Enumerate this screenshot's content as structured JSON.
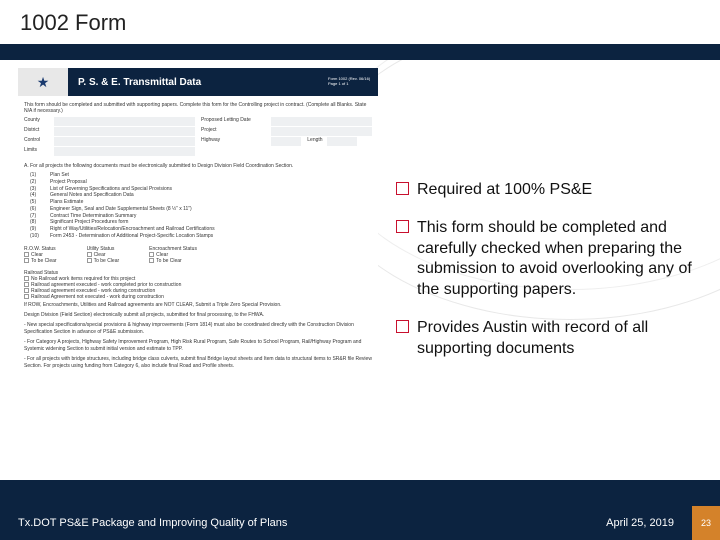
{
  "title": "1002 Form",
  "form_preview": {
    "header_title": "P. S. & E. Transmittal Data",
    "header_meta": "Form 1002\n(Rev. 06/16)\nPage 1 of 1",
    "intro": "This form should be completed and submitted with supporting papers. Complete this form for the Controlling project in contract. (Complete all Blanks. State N/A if necessary.)",
    "left_fields": [
      "County",
      "District",
      "Control",
      "Limits"
    ],
    "right_fields": [
      "Proposed Letting Date",
      "Project",
      "Highway"
    ],
    "length_label": "Length",
    "section_a": "A. For all projects the following documents must be electronically submitted to Design Division Field Coordination Section.",
    "docs": [
      "Plan Set",
      "Project Proposal",
      "List of Governing Specifications and Special Provisions",
      "General Notes and Specification Data",
      "Plans Estimate",
      "Engineer Sign, Seal and Date Supplemental Sheets (8 ½” x 11”)",
      "Contract Time Determination Summary",
      "Significant Project Procedures form",
      "Right of Way/Utilities/Relocation/Encroachment and Railroad Certifications",
      "Form 2453 - Determination of Additional Project-Specific Location Stamps"
    ],
    "status_labels": {
      "row": "R.O.W. Status",
      "util": "Utility Status",
      "enc": "Encroachment Status",
      "opts": [
        "Clear",
        "Clear",
        "Clear",
        "To be Clear",
        "To be Clear",
        "To be Clear"
      ]
    },
    "railroad": {
      "title": "Railroad Status",
      "items": [
        "No Railroad work items required for this project",
        "Railroad agreement executed - work completed prior to construction",
        "Railroad agreement executed - work during construction",
        "Railroad Agreement not executed - work during construction"
      ],
      "note": "If ROW, Encroachments, Utilities and Railroad agreements are NOT CLEAR, Submit a Triple Zero Special Provision."
    },
    "paras": [
      "Design Division (Field Section) electronically submit all projects, submitted for final processing, to the FHWA.",
      "- New special specifications/special provisions & highway improvements (Form 1814) must also be coordinated directly with the Construction Division Specification Section in advance of PS&E submission.",
      "- For Category A projects, Highway Safety Improvement Program, High Risk Rural Program, Safe Routes to School Program, Rail/Highway Program and Systemic widening Section to submit initial version and estimate to TPP.",
      "- For all projects with bridge structures, including bridge class culverts, submit final Bridge layout sheets and Item data to structural items to SR&R file Review Section. For projects using funding from Category 6, also include final Road and Profile sheets."
    ]
  },
  "bullets": [
    "Required at 100% PS&E",
    "This form should be completed and carefully checked when preparing the submission to avoid overlooking any of the supporting papers.",
    "Provides Austin with record of all supporting documents"
  ],
  "footer": {
    "left": "Tx.DOT PS&E Package and Improving Quality of Plans",
    "date": "April 25, 2019",
    "page": "23"
  }
}
